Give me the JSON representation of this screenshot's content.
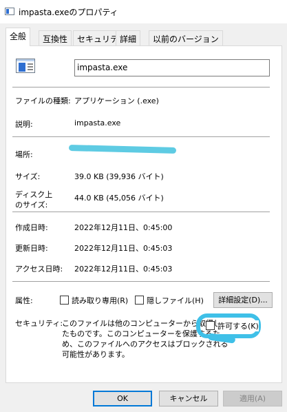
{
  "window": {
    "title": "impasta.exeのプロパティ"
  },
  "tabs": [
    {
      "label": "全般",
      "active": true
    },
    {
      "label": "互換性",
      "active": false
    },
    {
      "label": "セキュリティ",
      "active": false
    },
    {
      "label": "詳細",
      "active": false
    },
    {
      "label": "以前のバージョン",
      "active": false
    }
  ],
  "general": {
    "file_name": "impasta.exe",
    "type_label": "ファイルの種類:",
    "type_value": "アプリケーション (.exe)",
    "description_label": "説明:",
    "description_value": "impasta.exe",
    "location_label": "場所:",
    "size_label": "サイズ:",
    "size_value": "39.0 KB (39,936 バイト)",
    "disk_size_label_line1": "ディスク上",
    "disk_size_label_line2": "のサイズ:",
    "disk_size_value": "44.0 KB (45,056 バイト)",
    "created_label": "作成日時:",
    "created_value": "2022年12月11日、0:45:00",
    "modified_label": "更新日時:",
    "modified_value": "2022年12月11日、0:45:03",
    "accessed_label": "アクセス日時:",
    "accessed_value": "2022年12月11日、0:45:03",
    "attributes_label": "属性:",
    "readonly_label": "読み取り専用(R)",
    "hidden_label": "隠しファイル(H)",
    "advanced_button": "詳細設定(D)...",
    "security_label": "セキュリティ:",
    "security_text_line1": "このファイルは他のコンピューターから取得し",
    "security_text_line2": "たものです。このコンピューターを保護するた",
    "security_text_line3": "め、このファイルへのアクセスはブロックされる",
    "security_text_line4": "可能性があります。",
    "unblock_label": "許可する(K)"
  },
  "footer": {
    "ok": "OK",
    "cancel": "キャンセル",
    "apply": "適用(A)"
  },
  "colors": {
    "annotation": "#3fc0e8",
    "accent": "#0078d7"
  }
}
